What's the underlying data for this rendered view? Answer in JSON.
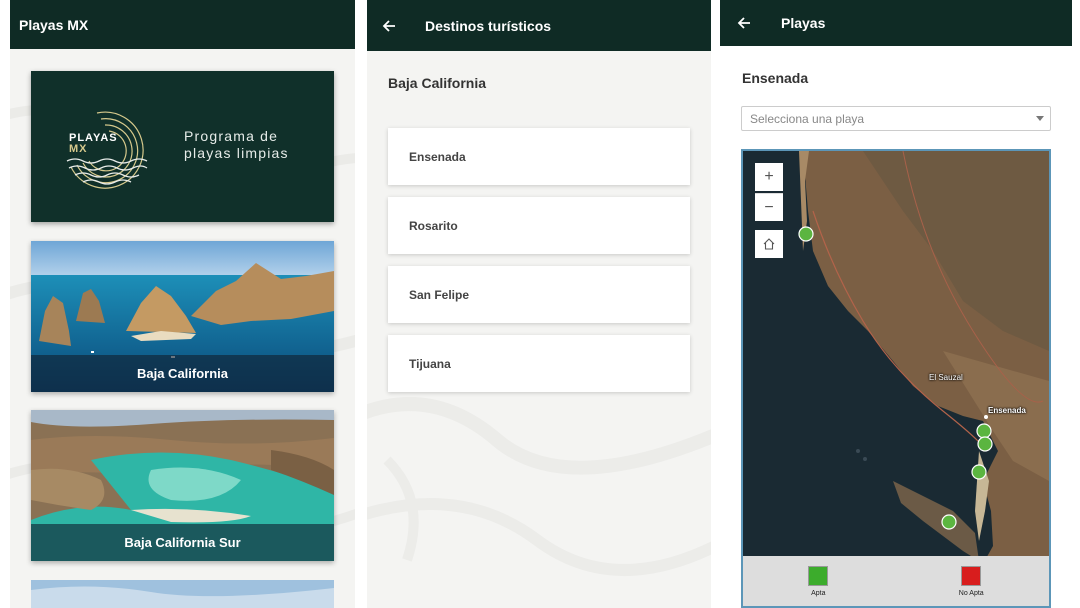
{
  "screen_home": {
    "app_title": "Playas MX",
    "banner": {
      "logo_line1": "PLAYAS",
      "logo_line2": "MX",
      "tagline_line1": "Programa de",
      "tagline_line2": "playas limpias"
    },
    "cards": [
      {
        "label": "Baja California"
      },
      {
        "label": "Baja California Sur"
      }
    ]
  },
  "screen_destinations": {
    "title": "Destinos turísticos",
    "state_title": "Baja California",
    "items": [
      {
        "label": "Ensenada"
      },
      {
        "label": "Rosarito"
      },
      {
        "label": "San Felipe"
      },
      {
        "label": "Tijuana"
      }
    ]
  },
  "screen_beaches": {
    "title": "Playas",
    "city_title": "Ensenada",
    "select": {
      "placeholder": "Selecciona una playa"
    },
    "map": {
      "zoom_in": "+",
      "zoom_out": "−",
      "labels": {
        "el_sauzal": "El Sauzal",
        "ensenada": "Ensenada"
      }
    },
    "legend": [
      {
        "label": "Apta",
        "color": "#3cac2c"
      },
      {
        "label": "No Apta",
        "color": "#d81d1d"
      }
    ]
  },
  "colors": {
    "appbar": "#0f2b25",
    "logo_accent": "#d6c98c"
  }
}
